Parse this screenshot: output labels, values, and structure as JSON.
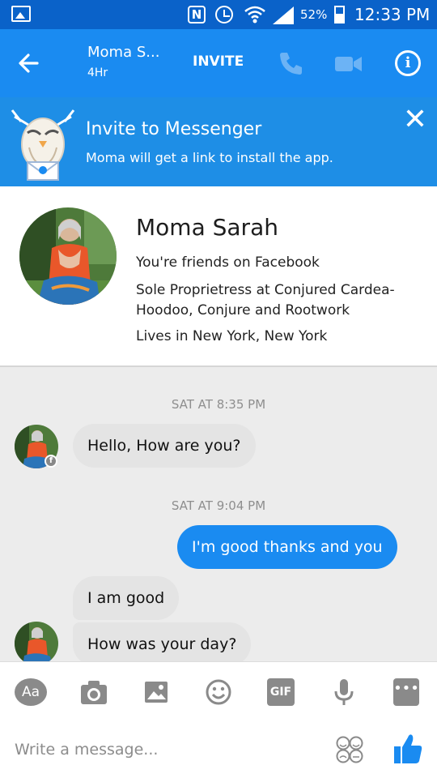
{
  "status_bar": {
    "battery_percent": "52%",
    "time": "12:33 PM",
    "nfc_letter": "N",
    "icons": [
      "gallery-icon",
      "nfc-icon",
      "alarm-icon",
      "wifi-icon",
      "signal-icon",
      "battery-icon"
    ]
  },
  "header": {
    "contact_name": "Moma S...",
    "contact_status": "4Hr",
    "invite_label": "INVITE",
    "info_glyph": "i"
  },
  "banner": {
    "title": "Invite to Messenger",
    "subtitle": "Moma will get a link to install the app.",
    "close_glyph": "✕"
  },
  "profile": {
    "name": "Moma Sarah",
    "line1": "You're friends on Facebook",
    "line2": "Sole Proprietress at Conjured Cardea-Hoodoo, Conjure and Rootwork",
    "line3": "Lives in New York, New York"
  },
  "messages": {
    "timestamp1": "SAT AT 8:35 PM",
    "timestamp2": "SAT AT 9:04 PM",
    "m1": "Hello, How are you?",
    "m2": "I'm good thanks and you",
    "m3": "I am good",
    "m4": "How was your day?",
    "badge": "f"
  },
  "composer": {
    "aa_label": "Aa",
    "gif_label": "GIF",
    "more_label": "•••",
    "placeholder": "Write a message..."
  },
  "colors": {
    "header_blue": "#1a8bf1",
    "status_bar_blue": "#0a62c9",
    "banner_blue": "#1e8ee6",
    "outgoing_bubble": "#1a8bf1",
    "incoming_bubble": "#e4e4e4"
  }
}
